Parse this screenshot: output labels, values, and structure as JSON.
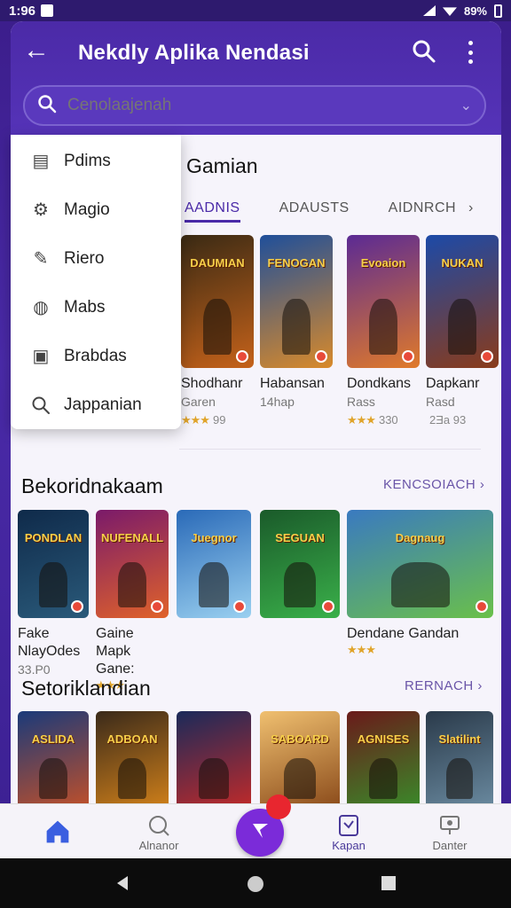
{
  "status_bar": {
    "time": "1:96",
    "battery": "89%"
  },
  "header": {
    "title": "Nekdly Aplika Nendasi",
    "search_placeholder": "Cenolaajenah"
  },
  "menu": {
    "items": [
      {
        "label": "Pdims",
        "icon": "book-icon"
      },
      {
        "label": "Magio",
        "icon": "gear-icon"
      },
      {
        "label": "Riero",
        "icon": "pencil-icon"
      },
      {
        "label": "Mabs",
        "icon": "globe-icon"
      },
      {
        "label": "Brabdas",
        "icon": "square-icon"
      },
      {
        "label": "Jappanian",
        "icon": "search-icon"
      }
    ]
  },
  "section1": {
    "title": "Gamian",
    "tabs": [
      "AADNIS",
      "ADAUSTS",
      "AIDNRCH"
    ],
    "cards": [
      {
        "art_title": "DAUMIAN",
        "name1": "Shodhanr",
        "name2": "Garen",
        "stars": "★★★",
        "rating": "99",
        "colors": [
          "#3a2a14",
          "#c5621a"
        ]
      },
      {
        "art_title": "FENOGAN",
        "name1": "Habansan",
        "name2": "14hap",
        "stars": "",
        "rating": "",
        "colors": [
          "#1f4f9a",
          "#d98a2a"
        ]
      },
      {
        "art_title": "Evoaion",
        "name1": "Dondkans",
        "name2": "Rass",
        "stars": "★★★",
        "rating": "330",
        "colors": [
          "#5b2a94",
          "#e07a2a"
        ]
      },
      {
        "art_title": "NUKAN",
        "name1": "Dapkanr",
        "name2": "Rasd",
        "stars": "",
        "rating": "2Ǝa 93",
        "colors": [
          "#1c4aa8",
          "#8a3b1a"
        ]
      }
    ]
  },
  "section2": {
    "title": "Bekoridnakaam",
    "link": "KENCSOIACH",
    "cards": [
      {
        "art_title": "PONDLAN",
        "name": "Fake NlayOdes",
        "meta": "33.P0",
        "stars": "",
        "colors": [
          "#0f2a4a",
          "#2a5a7a"
        ]
      },
      {
        "art_title": "NUFENALL",
        "name": "Gaine Mapk Gane:",
        "meta": "",
        "stars": "★★★",
        "colors": [
          "#7a1a6a",
          "#e0622a"
        ]
      },
      {
        "art_title": "Juegnor",
        "name": "",
        "meta": "",
        "stars": "",
        "colors": [
          "#2a6ab8",
          "#9ad0f0"
        ]
      },
      {
        "art_title": "SEGUAN",
        "name": "",
        "meta": "",
        "stars": "",
        "colors": [
          "#1a5a2a",
          "#3ab04a"
        ]
      },
      {
        "art_title": "Dagnaug",
        "name": "Dendane Gandan",
        "meta": "",
        "stars": "★★★",
        "colors": [
          "#3a7ac0",
          "#6ac04a"
        ]
      }
    ]
  },
  "section3": {
    "title": "Setoriklandian",
    "link": "RERNACH",
    "cards": [
      {
        "art_title": "ASLIDA",
        "colors": [
          "#1a3a7a",
          "#c0502a"
        ]
      },
      {
        "art_title": "ADBOAN",
        "colors": [
          "#3a2a1a",
          "#d0801a"
        ]
      },
      {
        "art_title": "",
        "colors": [
          "#1a2a5a",
          "#c02a2a"
        ]
      },
      {
        "art_title": "SABOARD",
        "colors": [
          "#f0c070",
          "#8a4a1a"
        ]
      },
      {
        "art_title": "AGNISES",
        "colors": [
          "#6a1a1a",
          "#3a8a2a"
        ]
      },
      {
        "art_title": "Slatilint",
        "colors": [
          "#2a3a4a",
          "#6a8aa0"
        ]
      }
    ]
  },
  "bottom_nav": {
    "items": [
      {
        "label": "",
        "icon": "home-icon"
      },
      {
        "label": "Alnanor",
        "icon": "compass-icon"
      },
      {
        "label": "Kapan",
        "icon": "document-icon"
      },
      {
        "label": "Danter",
        "icon": "monitor-icon"
      }
    ]
  },
  "colors": {
    "accent": "#4a2aa8",
    "fab": "#7b2bd9",
    "fab_badge": "#e8262f"
  }
}
